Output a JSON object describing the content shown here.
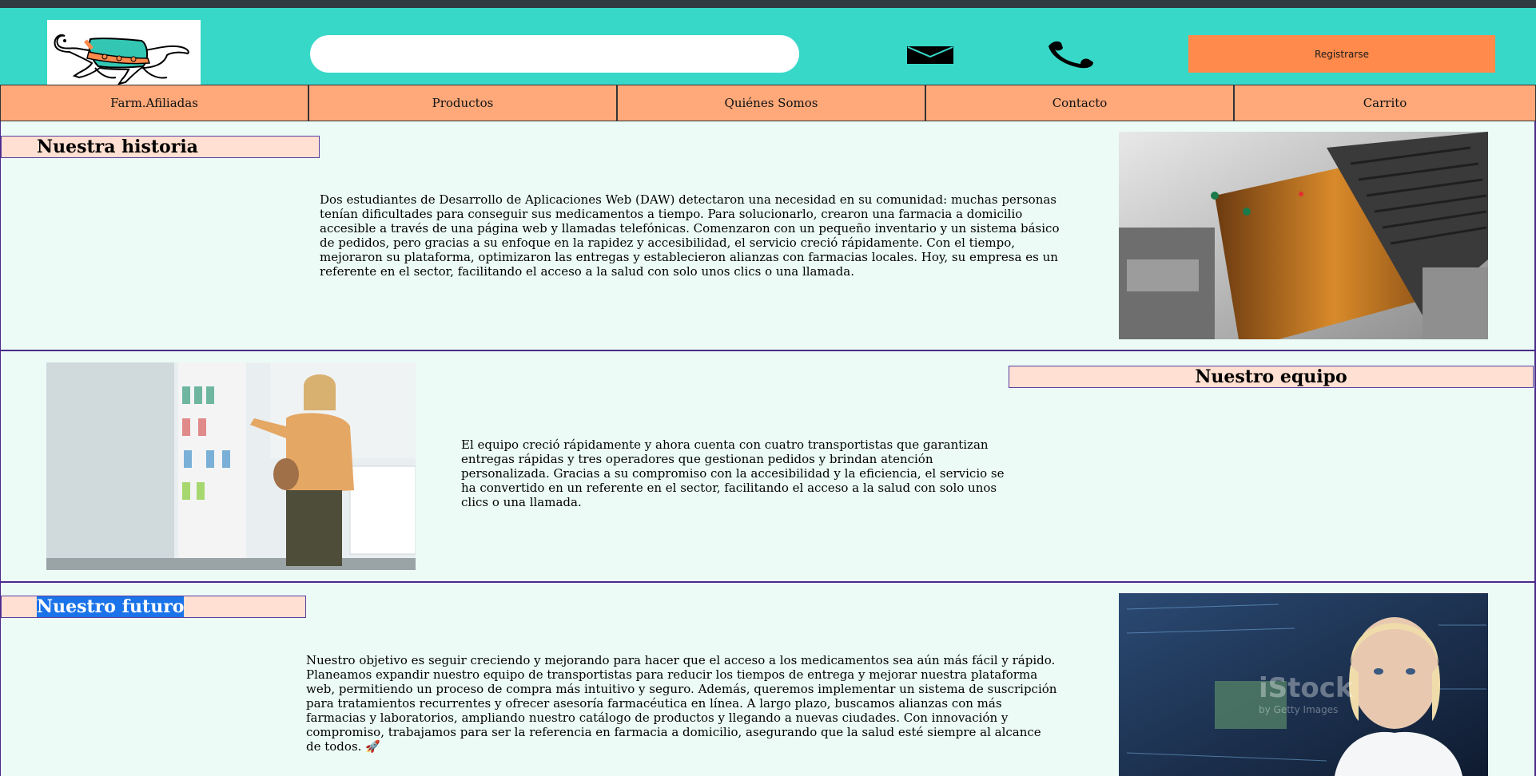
{
  "header": {
    "search_placeholder": "",
    "mail_icon": "envelope-icon",
    "phone_icon": "phone-icon",
    "register_label": "Registrarse",
    "logo_icon": "running-dog-logo"
  },
  "nav": {
    "items": [
      {
        "label": "Farm.Afiliadas"
      },
      {
        "label": "Productos"
      },
      {
        "label": "Quiénes Somos"
      },
      {
        "label": "Contacto"
      },
      {
        "label": "Carrito"
      }
    ]
  },
  "sections": {
    "historia": {
      "title": "Nuestra historia",
      "text": "Dos estudiantes de Desarrollo de Aplicaciones Web (DAW) detectaron una necesidad en su comunidad: muchas personas tenían dificultades para conseguir sus medicamentos a tiempo. Para solucionarlo, crearon una farmacia a domicilio accesible a través de una página web y llamadas telefónicas. Comenzaron con un pequeño inventario y un sistema básico de pedidos, pero gracias a su enfoque en la rapidez y accesibilidad, el servicio creció rápidamente. Con el tiempo, mejoraron su plataforma, optimizaron las entregas y establecieron alianzas con farmacias locales. Hoy, su empresa es un referente en el sector, facilitando el acceso a la salud con solo unos clics o una llamada."
    },
    "equipo": {
      "title": "Nuestro equipo",
      "text": "El equipo creció rápidamente y ahora cuenta con cuatro transportistas que garantizan entregas rápidas y tres operadores que gestionan pedidos y brindan atención personalizada. Gracias a su compromiso con la accesibilidad y la eficiencia, el servicio se ha convertido en un referente en el sector, facilitando el acceso a la salud con solo unos clics o una llamada."
    },
    "futuro": {
      "title": "Nuestro futuro",
      "text": "Nuestro objetivo es seguir creciendo y mejorando para hacer que el acceso a los medicamentos sea aún más fácil y rápido. Planeamos expandir nuestro equipo de transportistas para reducir los tiempos de entrega y mejorar nuestra plataforma web, permitiendo un proceso de compra más intuitivo y seguro. Además, queremos implementar un sistema de suscripción para tratamientos recurrentes y ofrecer asesoría farmacéutica en línea. A largo plazo, buscamos alianzas con más farmacias y laboratorios, ampliando nuestro catálogo de productos y llegando a nuevas ciudades. Con innovación y compromiso, trabajamos para ser la referencia en farmacia a domicilio, asegurando que la salud esté siempre al alcance de todos. 🚀",
      "watermark": "iStock",
      "watermark_sub": "by Getty Images"
    }
  },
  "colors": {
    "header_bg": "#38d8c9",
    "nav_bg": "#ffa97a",
    "register_bg": "#ff8a4c",
    "page_bg": "#ecfbf6",
    "title_bg": "#ffe0d2",
    "selection": "#1a73e8"
  }
}
